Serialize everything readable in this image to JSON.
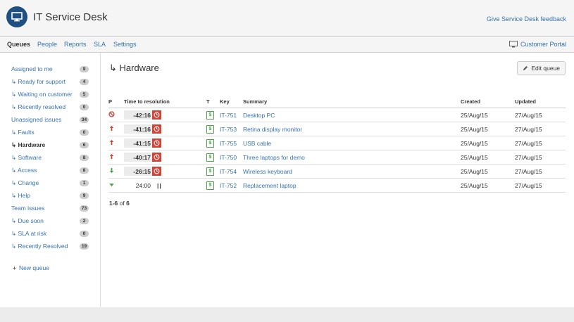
{
  "app": {
    "title": "IT Service Desk",
    "feedback_link": "Give Service Desk feedback"
  },
  "nav": {
    "tabs": [
      {
        "label": "Queues",
        "active": true
      },
      {
        "label": "People"
      },
      {
        "label": "Reports"
      },
      {
        "label": "SLA"
      },
      {
        "label": "Settings"
      }
    ],
    "portal": "Customer Portal"
  },
  "sidebar": {
    "items": [
      {
        "label": "Assigned to me",
        "count": "9"
      },
      {
        "label": "↳ Ready for support",
        "count": "4"
      },
      {
        "label": "↳ Waiting on customer",
        "count": "5"
      },
      {
        "label": "↳ Recently resolved",
        "count": "0"
      },
      {
        "label": "Unassigned issues",
        "count": "34"
      },
      {
        "label": "↳ Faults",
        "count": "0"
      },
      {
        "label": "↳ Hardware",
        "count": "6",
        "active": true
      },
      {
        "label": "↳ Software",
        "count": "8"
      },
      {
        "label": "↳ Access",
        "count": "8"
      },
      {
        "label": "↳ Change",
        "count": "1"
      },
      {
        "label": "↳ Help",
        "count": "9"
      },
      {
        "label": "Team issues",
        "count": "73"
      },
      {
        "label": "↳ Due soon",
        "count": "2"
      },
      {
        "label": "↳ SLA at risk",
        "count": "0"
      },
      {
        "label": "↳ Recently Resolved",
        "count": "19"
      }
    ],
    "new_queue": "New queue"
  },
  "main": {
    "title": "↳ Hardware",
    "edit_button": "Edit queue",
    "columns": {
      "p": "P",
      "ttr": "Time to resolution",
      "t": "T",
      "key": "Key",
      "summary": "Summary",
      "created": "Created",
      "updated": "Updated"
    },
    "rows": [
      {
        "priority": "blocker",
        "ttr": "-42:16",
        "breached": true,
        "key": "IT-751",
        "summary": "Desktop PC",
        "created": "25/Aug/15",
        "updated": "27/Aug/15"
      },
      {
        "priority": "major",
        "ttr": "-41:16",
        "breached": true,
        "key": "IT-753",
        "summary": "Retina display monitor",
        "created": "25/Aug/15",
        "updated": "27/Aug/15"
      },
      {
        "priority": "major",
        "ttr": "-41:15",
        "breached": true,
        "key": "IT-755",
        "summary": "USB cable",
        "created": "25/Aug/15",
        "updated": "27/Aug/15"
      },
      {
        "priority": "major",
        "ttr": "-40:17",
        "breached": true,
        "key": "IT-750",
        "summary": "Three laptops for demo",
        "created": "25/Aug/15",
        "updated": "27/Aug/15"
      },
      {
        "priority": "minor",
        "ttr": "-26:15",
        "breached": true,
        "key": "IT-754",
        "summary": "Wireless keyboard",
        "created": "25/Aug/15",
        "updated": "27/Aug/15"
      },
      {
        "priority": "trivial",
        "ttr": "24:00",
        "breached": false,
        "key": "IT-752",
        "summary": "Replacement laptop",
        "created": "25/Aug/15",
        "updated": "27/Aug/15"
      }
    ],
    "count": {
      "range": "1-6",
      "of": "of",
      "total": "6"
    }
  },
  "colors": {
    "accent": "#3572b0",
    "breach": "#d04437",
    "logo": "#205081",
    "type_icon": "#4aa34a"
  }
}
